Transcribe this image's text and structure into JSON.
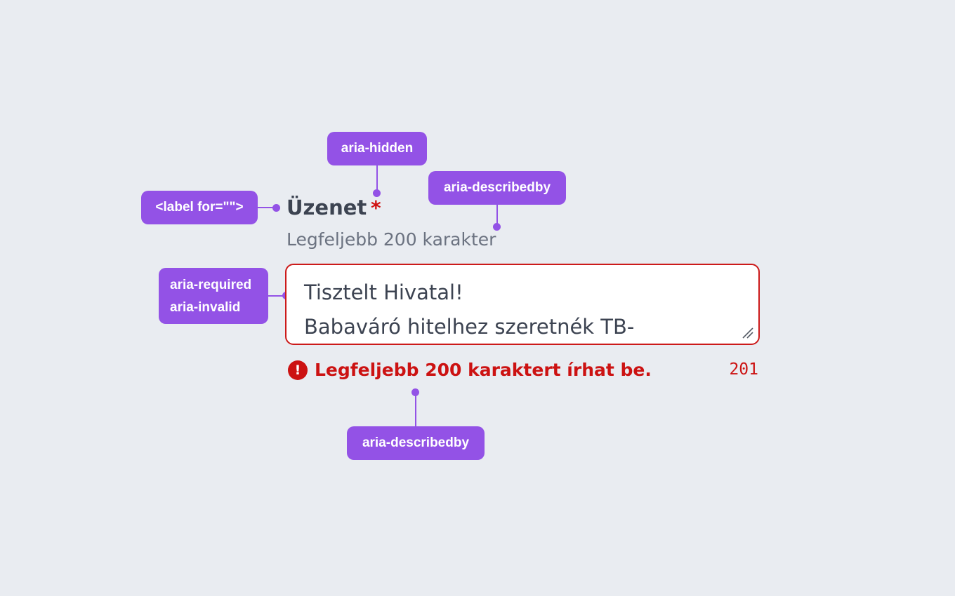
{
  "field": {
    "label": "Üzenet",
    "required_marker": "*",
    "hint": "Legfeljebb 200 karakter",
    "value_lines": [
      "Tisztelt Hivatal!",
      "Babaváró hitelhez szeretnék TB-"
    ],
    "error_icon": "!",
    "error_message": "Legfeljebb 200 karaktert írhat be.",
    "char_count": "201"
  },
  "annotations": {
    "label_for": "<label for=\"\">",
    "aria_hidden": "aria-hidden",
    "aria_describedby_hint": "aria-describedby",
    "aria_required": "aria-required",
    "aria_invalid": "aria-invalid",
    "aria_describedby_error": "aria-describedby"
  },
  "colors": {
    "annotation": "#9352e6",
    "error": "#cc1212",
    "text": "#3c4351",
    "hint": "#6b7280",
    "background": "#e9ecf1"
  },
  "icons": {
    "error_icon": "exclamation-circle-icon",
    "resize_icon": "resize-grip-icon"
  }
}
